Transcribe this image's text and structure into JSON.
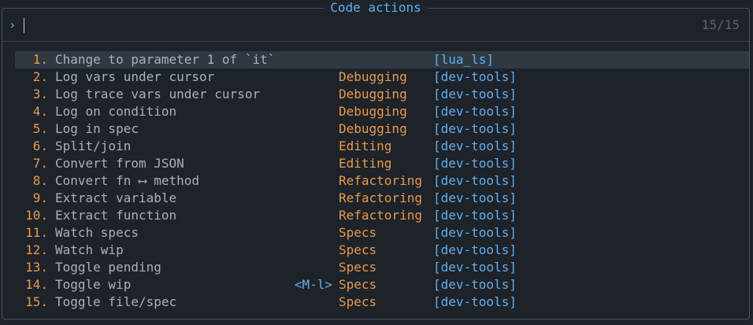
{
  "title": "Code actions",
  "prompt": {
    "icon": "›",
    "input_value": "",
    "counter": "15/15"
  },
  "items": [
    {
      "num": "1.",
      "label": "Change to parameter 1 of `it`",
      "key": "",
      "group": "",
      "source": "[lua_ls]"
    },
    {
      "num": "2.",
      "label": "Log vars under cursor",
      "key": "",
      "group": "Debugging",
      "source": "[dev-tools]"
    },
    {
      "num": "3.",
      "label": "Log trace vars under cursor",
      "key": "",
      "group": "Debugging",
      "source": "[dev-tools]"
    },
    {
      "num": "4.",
      "label": "Log on condition",
      "key": "",
      "group": "Debugging",
      "source": "[dev-tools]"
    },
    {
      "num": "5.",
      "label": "Log in spec",
      "key": "",
      "group": "Debugging",
      "source": "[dev-tools]"
    },
    {
      "num": "6.",
      "label": "Split/join",
      "key": "",
      "group": "Editing",
      "source": "[dev-tools]"
    },
    {
      "num": "7.",
      "label": "Convert from JSON",
      "key": "",
      "group": "Editing",
      "source": "[dev-tools]"
    },
    {
      "num": "8.",
      "label": "Convert fn ⟷ method",
      "key": "",
      "group": "Refactoring",
      "source": "[dev-tools]"
    },
    {
      "num": "9.",
      "label": "Extract variable",
      "key": "",
      "group": "Refactoring",
      "source": "[dev-tools]"
    },
    {
      "num": "10.",
      "label": "Extract function",
      "key": "",
      "group": "Refactoring",
      "source": "[dev-tools]"
    },
    {
      "num": "11.",
      "label": "Watch specs",
      "key": "",
      "group": "Specs",
      "source": "[dev-tools]"
    },
    {
      "num": "12.",
      "label": "Watch wip",
      "key": "",
      "group": "Specs",
      "source": "[dev-tools]"
    },
    {
      "num": "13.",
      "label": "Toggle pending",
      "key": "",
      "group": "Specs",
      "source": "[dev-tools]"
    },
    {
      "num": "14.",
      "label": "Toggle wip",
      "key": "<M-l>",
      "group": "Specs",
      "source": "[dev-tools]"
    },
    {
      "num": "15.",
      "label": "Toggle file/spec",
      "key": "",
      "group": "Specs",
      "source": "[dev-tools]"
    }
  ],
  "selected_index": 0,
  "colors": {
    "background": "#1e2229",
    "accent_blue": "#61afef",
    "accent_orange": "#e59a4f",
    "text": "#a9b1bd",
    "selection": "#2f3942"
  }
}
